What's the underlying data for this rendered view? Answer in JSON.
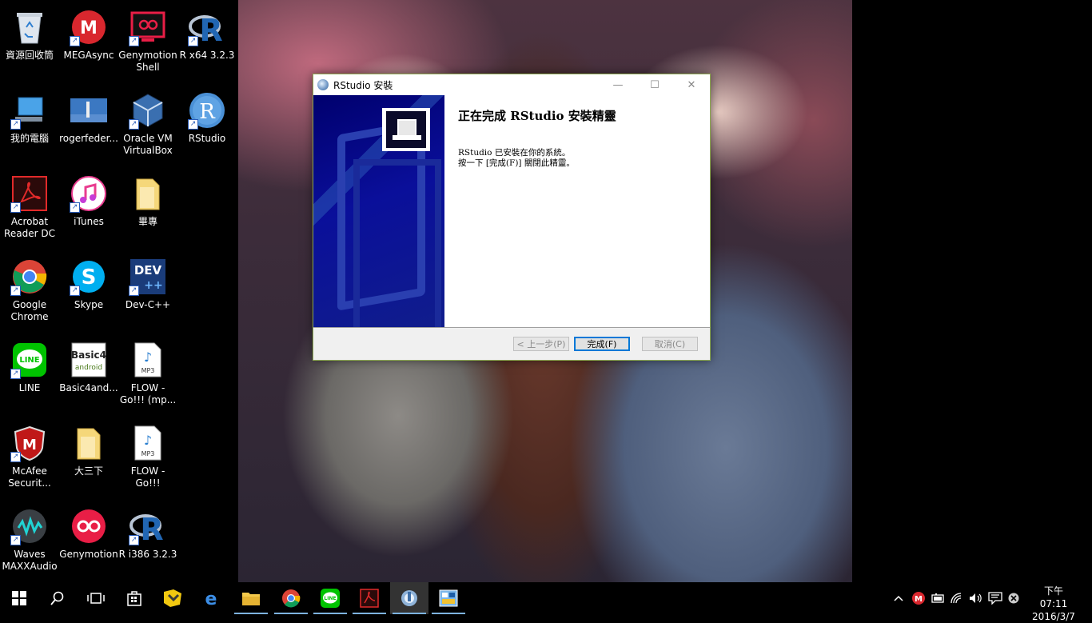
{
  "desktop": {
    "icons": [
      {
        "label": "資源回收筒",
        "icon": "recycle-bin-icon"
      },
      {
        "label": "MEGAsync",
        "icon": "megasync-icon"
      },
      {
        "label": "Genymotion Shell",
        "icon": "genymotion-shell-icon"
      },
      {
        "label": "R x64 3.2.3",
        "icon": "r-icon"
      },
      {
        "label": "我的電腦",
        "icon": "computer-icon"
      },
      {
        "label": "rogerfeder...",
        "icon": "image-file-icon"
      },
      {
        "label": "Oracle VM VirtualBox",
        "icon": "virtualbox-icon"
      },
      {
        "label": "RStudio",
        "icon": "rstudio-icon"
      },
      {
        "label": "Acrobat Reader DC",
        "icon": "acrobat-icon"
      },
      {
        "label": "iTunes",
        "icon": "itunes-icon"
      },
      {
        "label": "畢專",
        "icon": "folder-icon"
      },
      {
        "label": "Google Chrome",
        "icon": "chrome-icon"
      },
      {
        "label": "Skype",
        "icon": "skype-icon"
      },
      {
        "label": "Dev-C++",
        "icon": "devcpp-icon"
      },
      {
        "label": "LINE",
        "icon": "line-icon"
      },
      {
        "label": "Basic4and...",
        "icon": "basic4android-icon"
      },
      {
        "label": "FLOW - Go!!! (mp...",
        "icon": "mp3-file-icon"
      },
      {
        "label": "McAfee Securit...",
        "icon": "mcafee-icon"
      },
      {
        "label": "大三下",
        "icon": "folder-icon"
      },
      {
        "label": "FLOW - Go!!!",
        "icon": "mp3-file-icon"
      },
      {
        "label": "Waves MAXXAudio",
        "icon": "waves-icon"
      },
      {
        "label": "Genymotion",
        "icon": "genymotion-icon"
      },
      {
        "label": "R i386 3.2.3",
        "icon": "r-icon"
      }
    ]
  },
  "window": {
    "title": "RStudio 安裝",
    "heading": "正在完成 RStudio 安裝精靈",
    "line1": "RStudio 已安裝在你的系統。",
    "line2": "按一下 [完成(F)] 關閉此精靈。",
    "back_label": "< 上一步(P)",
    "finish_label": "完成(F)",
    "cancel_label": "取消(C)",
    "min_glyph": "—",
    "max_glyph": "☐",
    "close_glyph": "✕"
  },
  "taskbar": {
    "items": [
      {
        "icon": "start-icon"
      },
      {
        "icon": "search-icon"
      },
      {
        "icon": "task-view-icon"
      },
      {
        "icon": "store-icon"
      },
      {
        "icon": "pinned-app-icon"
      },
      {
        "icon": "edge-icon"
      },
      {
        "icon": "file-explorer-icon"
      },
      {
        "icon": "chrome-icon"
      },
      {
        "icon": "line-icon"
      },
      {
        "icon": "acrobat-icon"
      },
      {
        "icon": "installer-icon"
      },
      {
        "icon": "control-panel-icon"
      }
    ],
    "clock_time": "下午 07:11",
    "clock_date": "2016/3/7"
  },
  "colors": {
    "accent": "#0078d7",
    "banner": "#0a0f9a",
    "window_border": "#8ba750"
  }
}
